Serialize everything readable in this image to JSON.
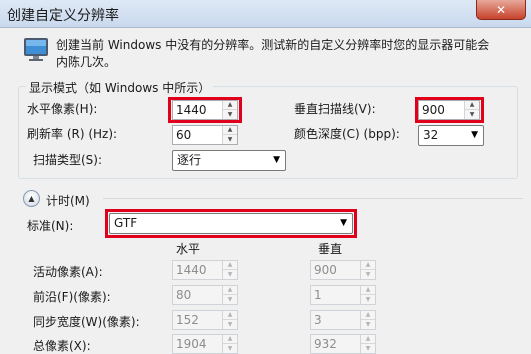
{
  "window": {
    "title": "创建自定义分辨率",
    "close_glyph": "✕"
  },
  "intro": "创建当前 Windows 中没有的分辨率。测试新的自定义分辨率时您的显示器可能会内陈几次。",
  "display_mode": {
    "group_title": "显示模式（如 Windows 中所示）",
    "h_pixels": {
      "label": "水平像素(H):",
      "value": "1440"
    },
    "v_scanlines": {
      "label": "垂直扫描线(V):",
      "value": "900"
    },
    "refresh": {
      "label": "刷新率 (R) (Hz):",
      "value": "60"
    },
    "color_depth": {
      "label": "颜色深度(C) (bpp):",
      "value": "32"
    },
    "scan_type": {
      "label": "扫描类型(S):",
      "value": "逐行"
    }
  },
  "timing": {
    "toggle_label": "计时(M)",
    "standard": {
      "label": "标准(N):",
      "value": "GTF"
    },
    "col_horizontal": "水平",
    "col_vertical": "垂直",
    "rows": [
      {
        "label": "活动像素(A):",
        "h": "1440",
        "v": "900"
      },
      {
        "label": "前沿(F)(像素):",
        "h": "80",
        "v": "1"
      },
      {
        "label": "同步宽度(W)(像素):",
        "h": "152",
        "v": "3"
      },
      {
        "label": "总像素(X):",
        "h": "1904",
        "v": "932"
      }
    ]
  },
  "colors": {
    "highlight": "#e0001b",
    "titlebar": "#c9d9ee",
    "background": "#f0f0f0"
  },
  "icons": {
    "window": "monitor-icon",
    "expander": "collapse-arrow-icon",
    "combo": "chevron-down-icon",
    "spin": "spin-arrows-icon"
  }
}
